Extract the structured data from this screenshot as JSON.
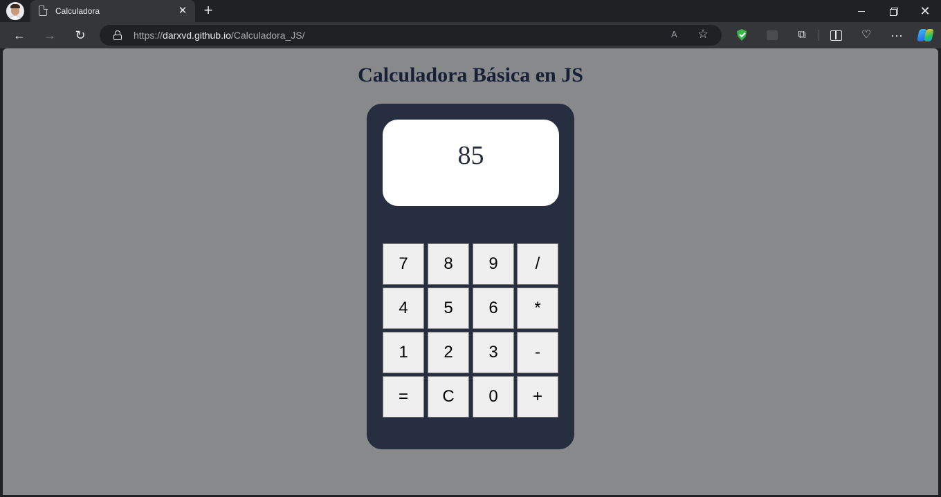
{
  "browser": {
    "tab_title": "Calculadora",
    "tab_close": "✕",
    "new_tab": "+",
    "address": {
      "scheme": "https://",
      "host": "darxvd.github.io",
      "path": "/Calculadora_JS/"
    },
    "read_aloud": "A",
    "icons": {
      "back": "←",
      "forward": "→",
      "reload": "↻",
      "favorite": "☆",
      "extensions": "⧉",
      "health": "♡",
      "more": "···",
      "close_window": "✕"
    }
  },
  "page": {
    "title": "Calculadora Básica en JS",
    "display_value": "85",
    "keys": [
      [
        "7",
        "8",
        "9",
        "/"
      ],
      [
        "4",
        "5",
        "6",
        "*"
      ],
      [
        "1",
        "2",
        "3",
        "-"
      ],
      [
        "=",
        "C",
        "0",
        "+"
      ]
    ]
  },
  "colors": {
    "page_background": "#88898b",
    "calculator_body": "#262e40",
    "title_text": "#162036",
    "key_background": "#efefef"
  }
}
